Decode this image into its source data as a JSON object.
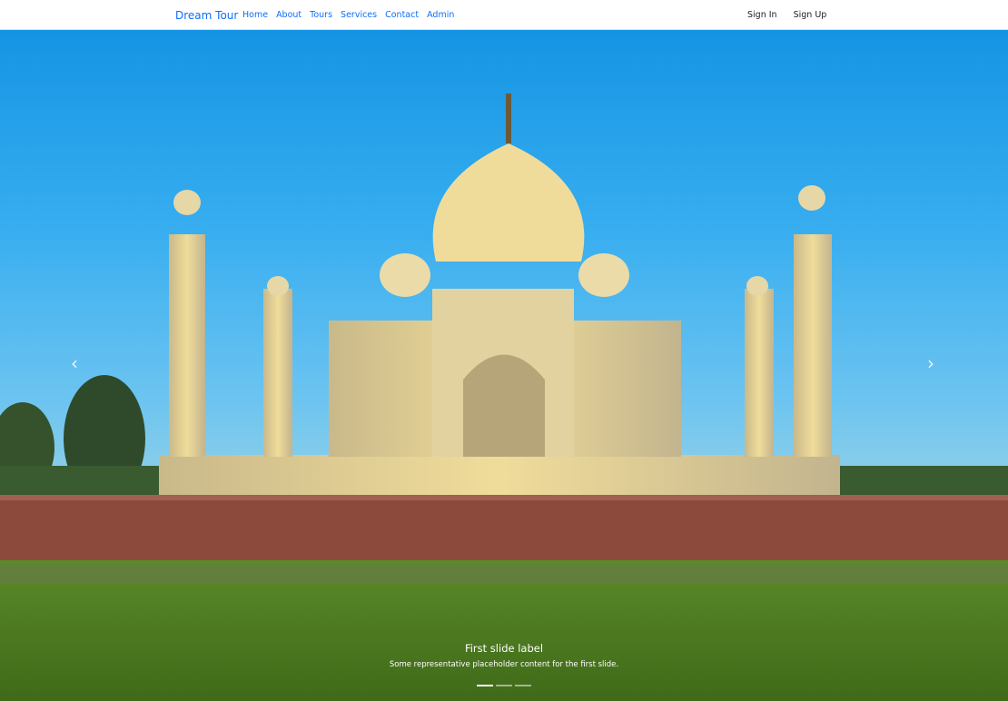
{
  "nav": {
    "brand": "Dream Tour",
    "links": [
      "Home",
      "About",
      "Tours",
      "Services",
      "Contact",
      "Admin"
    ],
    "sign_in": "Sign In",
    "sign_up": "Sign Up"
  },
  "carousel": {
    "slide_label": "First slide label",
    "slide_text": "Some representative placeholder content for the first slide.",
    "active_index": 0,
    "slide_count": 3,
    "prev_icon": "chevron-left-icon",
    "next_icon": "chevron-right-icon"
  }
}
